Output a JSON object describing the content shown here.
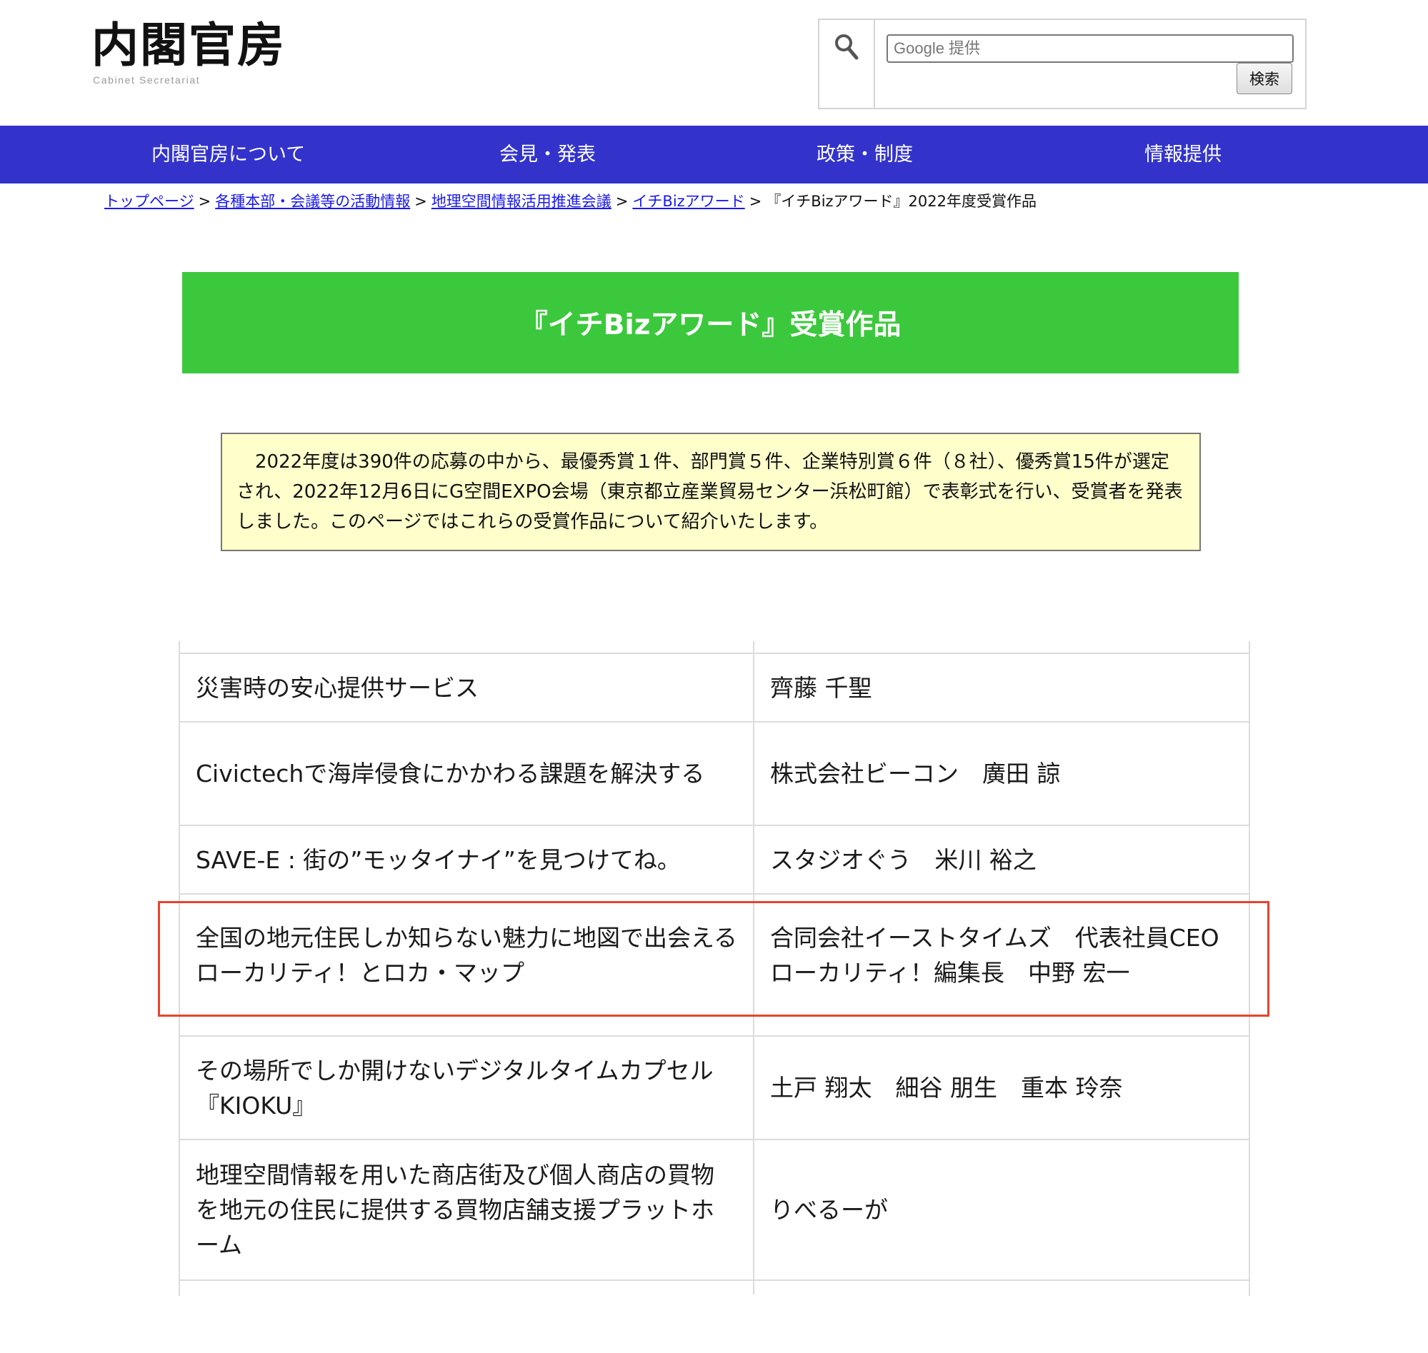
{
  "header": {
    "logo_main": "内閣官房",
    "logo_sub": "Cabinet Secretariat",
    "search": {
      "placeholder": "Google 提供",
      "button_label": "検索"
    }
  },
  "nav": {
    "items": [
      {
        "label": "内閣官房について"
      },
      {
        "label": "会見・発表"
      },
      {
        "label": "政策・制度"
      },
      {
        "label": "情報提供"
      }
    ]
  },
  "breadcrumb": {
    "links": [
      {
        "label": "トップページ"
      },
      {
        "label": "各種本部・会議等の活動情報"
      },
      {
        "label": "地理空間情報活用推進会議"
      },
      {
        "label": "イチBizアワード"
      }
    ],
    "separator": ">",
    "current": "『イチBizアワード』2022年度受賞作品"
  },
  "page": {
    "title": "『イチBizアワード』受賞作品",
    "intro": "2022年度は390件の応募の中から、最優秀賞１件、部門賞５件、企業特別賞６件（８社）、優秀賞15件が選定され、2022年12月6日にG空間EXPO会場（東京都立産業貿易センター浜松町館）で表彰式を行い、受賞者を発表しました。このページではこれらの受賞作品について紹介いたします。"
  },
  "awards_table": {
    "rows": [
      {
        "title": "災害時の安心提供サービス",
        "winner": "齊藤 千聖"
      },
      {
        "title": "Civictechで海岸侵食にかかわる課題を解決する",
        "winner": "株式会社ビーコン　廣田 諒"
      },
      {
        "title": "SAVE-E : 街の”モッタイナイ”を見つけてね。",
        "winner": "スタジオぐう　米川 裕之"
      },
      {
        "title": "全国の地元住民しか知らない魅力に地図で出会えるローカリティ！とロカ・マップ",
        "winner": "合同会社イーストタイムズ　代表社員CEO　 ローカリティ！編集長　中野 宏一"
      },
      {
        "title": "",
        "winner": ""
      },
      {
        "title": "その場所でしか開けないデジタルタイムカプセル『KIOKU』",
        "winner": "土戸 翔太　細谷 朋生　重本 玲奈"
      },
      {
        "title": "地理空間情報を用いた商店街及び個人商店の買物を地元の住民に提供する買物店舗支援プラットホーム",
        "winner": "りべるーが"
      }
    ]
  },
  "colors": {
    "nav_background": "#3333cc",
    "title_banner": "#3cc83c",
    "intro_background": "#ffffcc",
    "link": "#1a1aee",
    "highlight_border": "#e8442d"
  },
  "icons": {
    "search": "search-icon"
  }
}
